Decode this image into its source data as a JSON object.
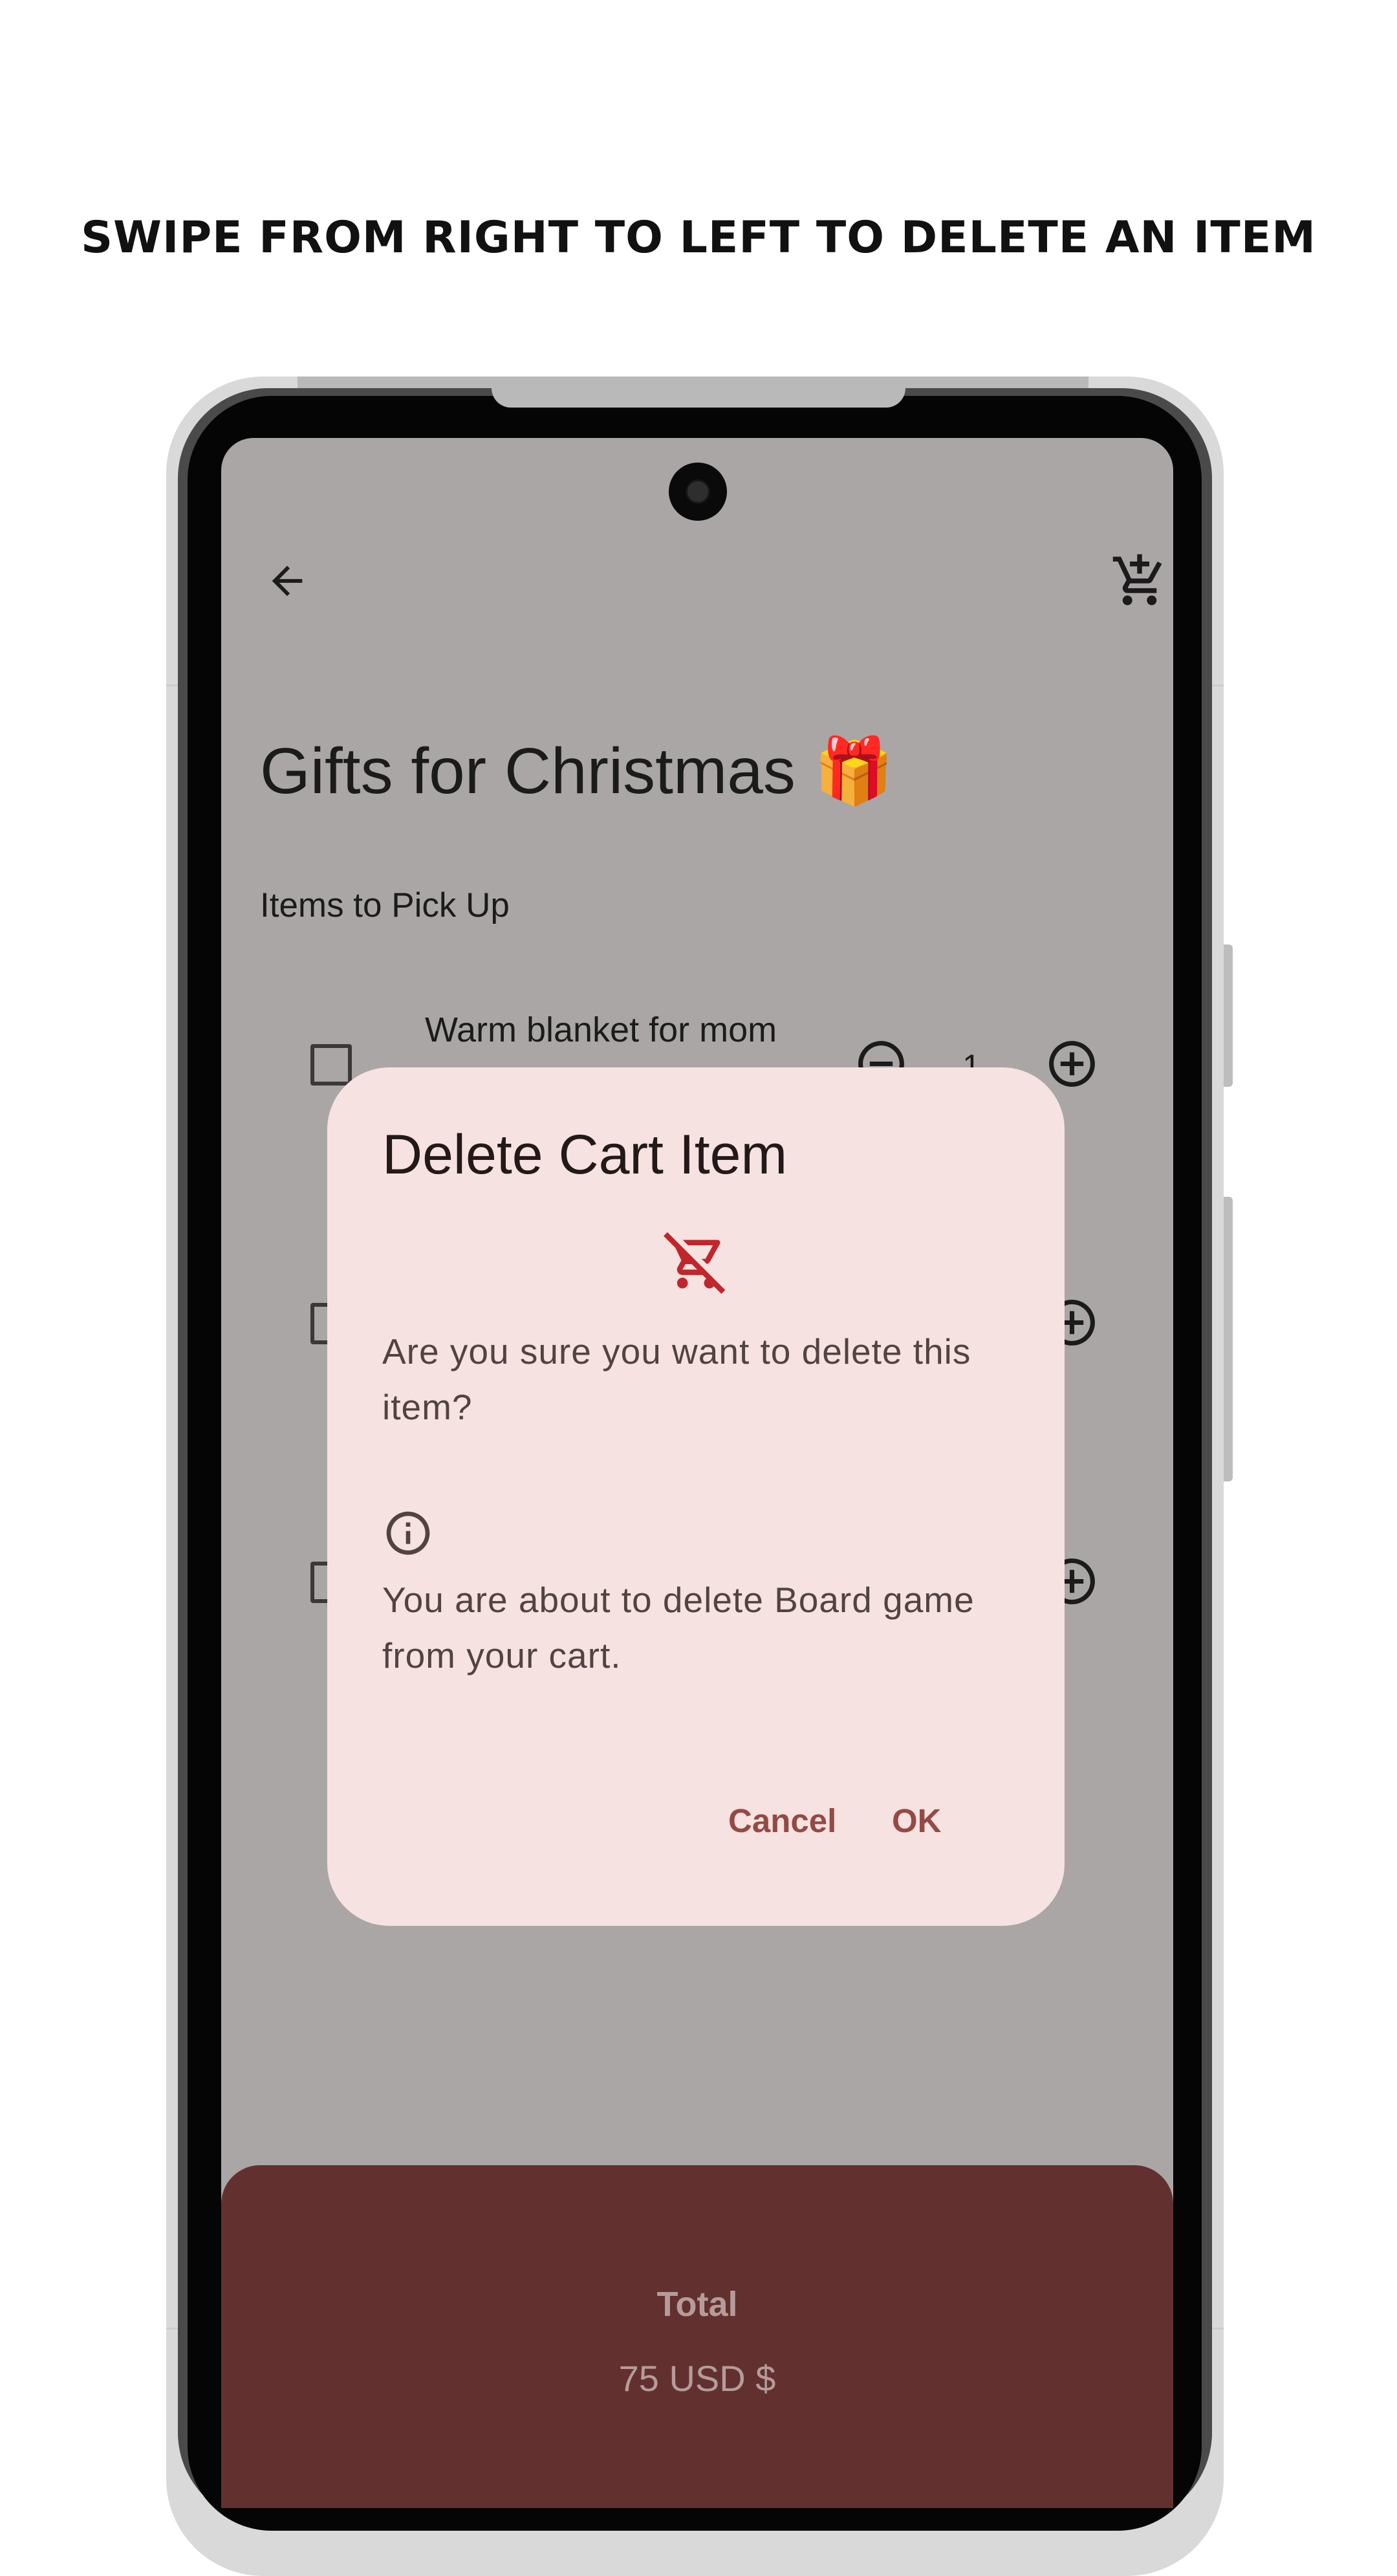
{
  "headline": "SWIPE FROM RIGHT TO LEFT TO DELETE AN ITEM",
  "app": {
    "page_title": "Gifts for Christmas 🎁",
    "section_title": "Items to Pick Up",
    "items": [
      {
        "name": "Warm blanket for mom",
        "quantity": "1"
      }
    ],
    "total_label": "Total",
    "total_value": "75 USD $"
  },
  "dialog": {
    "title": "Delete Cart Item",
    "question": "Are you sure you want to delete this item?",
    "detail": "You are about to delete Board game from your cart.",
    "cancel_label": "Cancel",
    "ok_label": "OK"
  },
  "icons": {
    "back": "arrow-back-icon",
    "add_cart": "add-shopping-cart-icon",
    "remove_cart": "remove-shopping-cart-icon",
    "info": "info-icon",
    "minus": "minus-circle-icon",
    "plus": "plus-circle-icon"
  },
  "colors": {
    "scrim": "#aaa6a6",
    "dialog_bg": "#f6e2e0",
    "accent": "#934a45",
    "danger_icon": "#c0262b",
    "total_sheet": "#62312f"
  }
}
